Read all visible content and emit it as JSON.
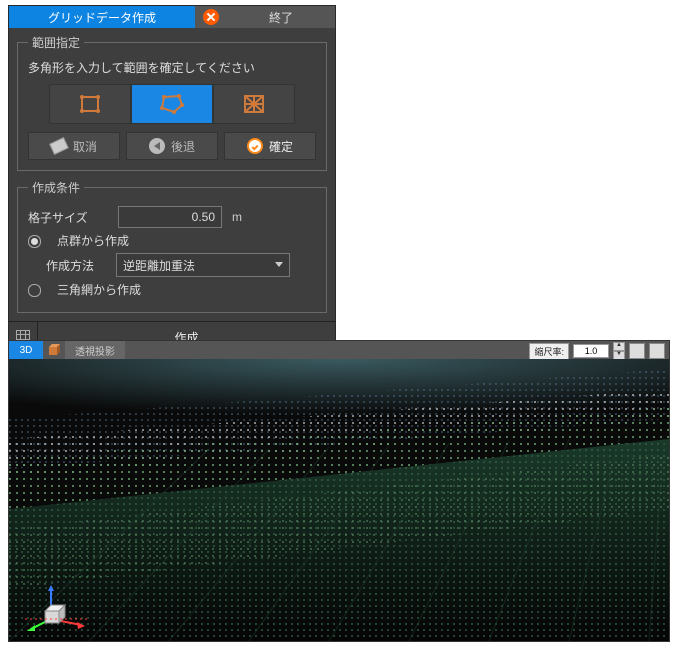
{
  "title_tab": "グリッドデータ作成",
  "end_tab": "終了",
  "range_section": {
    "legend": "範囲指定",
    "hint": "多角形を入力して範囲を確定してください",
    "shape_buttons": [
      "rectangle",
      "polygon",
      "mesh"
    ],
    "selected_shape_index": 1,
    "actions": {
      "cancel": "取消",
      "back": "後退",
      "confirm": "確定"
    }
  },
  "cond_section": {
    "legend": "作成条件",
    "grid_size_label": "格子サイズ",
    "grid_size_value": "0.50",
    "grid_size_unit": "m",
    "radio_pointcloud": "点群から作成",
    "method_label": "作成方法",
    "method_value": "逆距離加重法",
    "radio_tin": "三角網から作成",
    "selected_radio": "pointcloud"
  },
  "footer_create": "作成",
  "viewport": {
    "tab_3d": "3D",
    "tab_proj": "透視投影",
    "zoom_label": "縮尺率:",
    "zoom_value": "1.0"
  }
}
